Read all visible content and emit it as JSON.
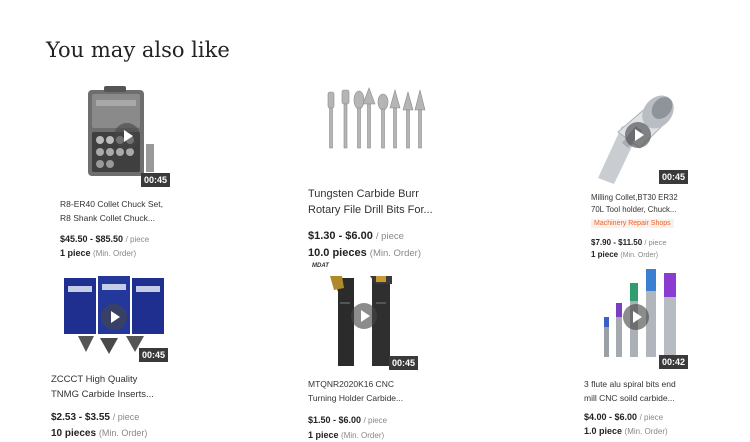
{
  "section": {
    "title": "You may also like"
  },
  "products": [
    {
      "title_line1": "R8-ER40 Collet Chuck Set,",
      "title_line2": "R8 Shank Collet Chuck...",
      "price": "$45.50 - $85.50",
      "price_unit": "/ piece",
      "moq": "1 piece",
      "moq_unit": "(Min. Order)",
      "video_duration": "00:45",
      "image": "collet-chuck-set-case"
    },
    {
      "title_line1": "Tungsten Carbide Burr",
      "title_line2": "Rotary File Drill Bits For...",
      "price": "$1.30 - $6.00",
      "price_unit": "/ piece",
      "moq": "10.0 pieces",
      "moq_unit": "(Min. Order)",
      "image": "carbide-burr-bits"
    },
    {
      "title_line1": "Milling Collet,BT30 ER32",
      "title_line2": "70L Tool holder, Chuck...",
      "tag": "Machinery Repair Shops",
      "price": "$7.90 - $11.50",
      "price_unit": "/ piece",
      "moq": "1 piece",
      "moq_unit": "(Min. Order)",
      "video_duration": "00:45",
      "image": "bt30-tool-holder"
    },
    {
      "title_line1": "ZCCCT High Quality",
      "title_line2": "TNMG Carbide Inserts...",
      "price": "$2.53 - $3.55",
      "price_unit": "/ piece",
      "moq": "10 pieces",
      "moq_unit": "(Min. Order)",
      "video_duration": "00:45",
      "image": "carbide-insert-boxes"
    },
    {
      "title_line1": "MTQNR2020K16 CNC",
      "title_line2": "Turning Holder Carbide...",
      "price": "$1.50 - $6.00",
      "price_unit": "/ piece",
      "moq": "1 piece",
      "moq_unit": "(Min. Order)",
      "video_duration": "00:45",
      "brand_mark": "MDAT",
      "image": "turning-holder"
    },
    {
      "title_line1": "3 flute alu spiral bits end",
      "title_line2": "mill CNC soild carbide...",
      "price": "$4.00 - $6.00",
      "price_unit": "/ piece",
      "moq": "1.0 piece",
      "moq_unit": "(Min. Order)",
      "video_duration": "00:42",
      "image": "end-mill-bits"
    }
  ]
}
